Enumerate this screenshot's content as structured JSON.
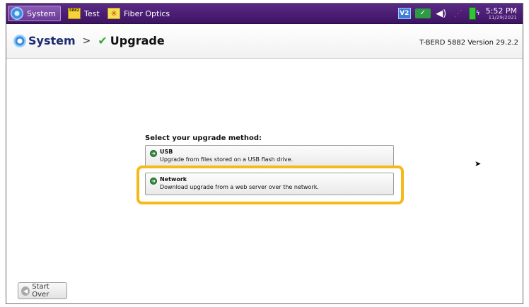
{
  "taskbar": {
    "tabs": [
      {
        "label": "System",
        "icon": "gear-icon",
        "active": true
      },
      {
        "label": "Test",
        "icon": "test-set-icon",
        "active": false
      },
      {
        "label": "Fiber Optics",
        "icon": "fiber-optics-icon",
        "active": false
      }
    ],
    "tray": {
      "v2_label": "V2",
      "time": "5:52 PM",
      "date": "11/29/2021"
    },
    "accent_color": "#4a1c72"
  },
  "titlebar": {
    "breadcrumb_root": "System",
    "separator": ">",
    "breadcrumb_current": "Upgrade",
    "version": "T-BERD 5882 Version 29.2.2"
  },
  "main": {
    "prompt": "Select your upgrade method:",
    "options": [
      {
        "name": "USB",
        "description": "Upgrade from files stored on a USB flash drive."
      },
      {
        "name": "Network",
        "description": "Download upgrade from a web server over the network."
      }
    ],
    "highlight_color": "#f6b91a"
  },
  "footer": {
    "start_over_label": "Start Over"
  }
}
